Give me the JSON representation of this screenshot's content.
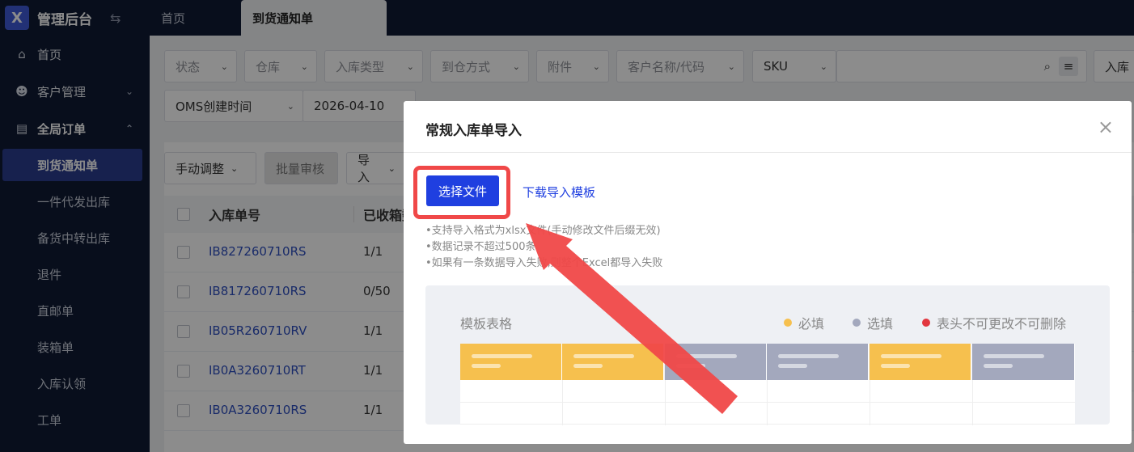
{
  "brand": {
    "title": "管理后台"
  },
  "tabs": [
    {
      "label": "首页"
    },
    {
      "label": "到货通知单"
    }
  ],
  "sidebar": {
    "items": [
      {
        "label": "首页",
        "icon": "home-icon"
      },
      {
        "label": "客户管理",
        "icon": "users-icon"
      },
      {
        "label": "全局订单",
        "icon": "clipboard-icon"
      }
    ],
    "subitems": [
      {
        "label": "到货通知单"
      },
      {
        "label": "一件代发出库"
      },
      {
        "label": "备货中转出库"
      },
      {
        "label": "退件"
      },
      {
        "label": "直邮单"
      },
      {
        "label": "装箱单"
      },
      {
        "label": "入库认领"
      },
      {
        "label": "工单"
      }
    ]
  },
  "filters": {
    "status": "状态",
    "warehouse": "仓库",
    "inbound_type": "入库类型",
    "arrival_method": "到仓方式",
    "attachment": "附件",
    "customer": "客户名称/代码",
    "sku": "SKU",
    "inbound_right": "入库",
    "oms_time": "OMS创建时间",
    "date_from": "2026-04-10"
  },
  "toolbar": {
    "manual_adjust": "手动调整",
    "batch_review": "批量审核",
    "import": "导入"
  },
  "table": {
    "headers": {
      "order_no": "入库单号",
      "received": "已收箱数"
    },
    "rows": [
      {
        "order_no": "IB827260710RS",
        "received": "1/1"
      },
      {
        "order_no": "IB817260710RS",
        "received": "0/50"
      },
      {
        "order_no": "IB05R260710RV",
        "received": "1/1"
      },
      {
        "order_no": "IB0A3260710RT",
        "received": "1/1"
      },
      {
        "order_no": "IB0A3260710RS",
        "received": "1/1"
      }
    ]
  },
  "modal": {
    "title": "常规入库单导入",
    "choose_file": "选择文件",
    "download_template": "下载导入模板",
    "tips": [
      "•支持导入格式为xlsx文件(手动修改文件后缀无效)",
      "•数据记录不超过500条",
      "•如果有一条数据导入失败,则整个Excel都导入失败"
    ],
    "template": {
      "title": "模板表格",
      "legend": [
        {
          "label": "必填",
          "color": "#f6c04e"
        },
        {
          "label": "选填",
          "color": "#a3a8bd"
        },
        {
          "label": "表头不可更改不可删除",
          "color": "#e2373f"
        }
      ]
    }
  },
  "colors": {
    "sidebar_bg": "#0f1a33",
    "primary": "#1f3fe0",
    "annotation": "#f04848"
  }
}
